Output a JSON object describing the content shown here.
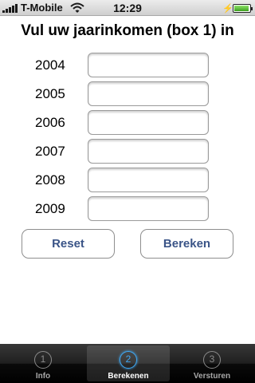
{
  "status_bar": {
    "carrier": "T-Mobile",
    "time": "12:29",
    "battery_level": 0.95,
    "icons": [
      "signal-icon",
      "wifi-icon",
      "charging-icon",
      "battery-icon"
    ]
  },
  "page": {
    "title": "Vul uw jaarinkomen (box 1) in"
  },
  "income_rows": [
    {
      "year": "2004",
      "value": "",
      "placeholder": ""
    },
    {
      "year": "2005",
      "value": "",
      "placeholder": ""
    },
    {
      "year": "2006",
      "value": "",
      "placeholder": ""
    },
    {
      "year": "2007",
      "value": "",
      "placeholder": ""
    },
    {
      "year": "2008",
      "value": "",
      "placeholder": ""
    },
    {
      "year": "2009",
      "value": "",
      "placeholder": ""
    }
  ],
  "buttons": {
    "reset_label": "Reset",
    "calculate_label": "Bereken"
  },
  "tab_bar": {
    "tabs": [
      {
        "number": "1",
        "label": "Info",
        "selected": false
      },
      {
        "number": "2",
        "label": "Berekenen",
        "selected": true
      },
      {
        "number": "3",
        "label": "Versturen",
        "selected": false
      }
    ]
  },
  "colors": {
    "button_text": "#3a5487",
    "selected_tab_accent": "#3fa9f5"
  }
}
